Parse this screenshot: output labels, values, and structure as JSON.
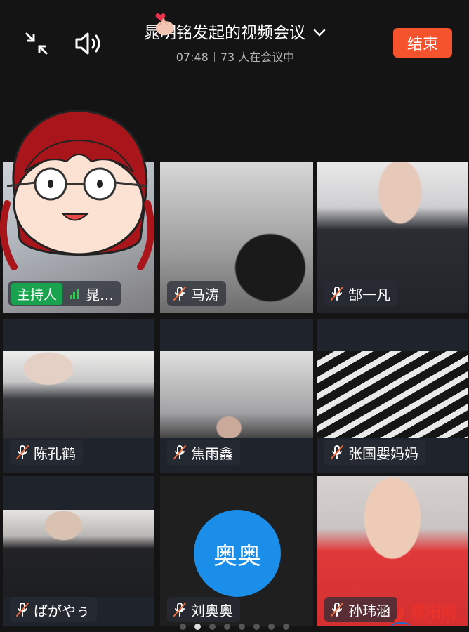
{
  "header": {
    "title": "晁明铭发起的视频会议",
    "time": "07:48",
    "participants": "73 人在会议中",
    "end_label": "结束"
  },
  "tiles": [
    {
      "name": "晁…",
      "host_label": "主持人"
    },
    {
      "name": "马涛"
    },
    {
      "name": "郜一凡"
    },
    {
      "name": "陈孔鹤"
    },
    {
      "name": "焦雨鑫"
    },
    {
      "name": "张国嬰妈妈"
    },
    {
      "name": "ばがやぅ"
    },
    {
      "name": "刘奥奥",
      "avatar_text": "奥奥"
    },
    {
      "name": "孙玮涵"
    }
  ],
  "watermark": {
    "text": "濮阳网",
    "url": "www.pyxww.com"
  },
  "pager": {
    "count": 8,
    "active": 1
  },
  "colors": {
    "end_button": "#f5532d",
    "host_badge": "#19a34f",
    "avatar": "#1a8ee8"
  }
}
